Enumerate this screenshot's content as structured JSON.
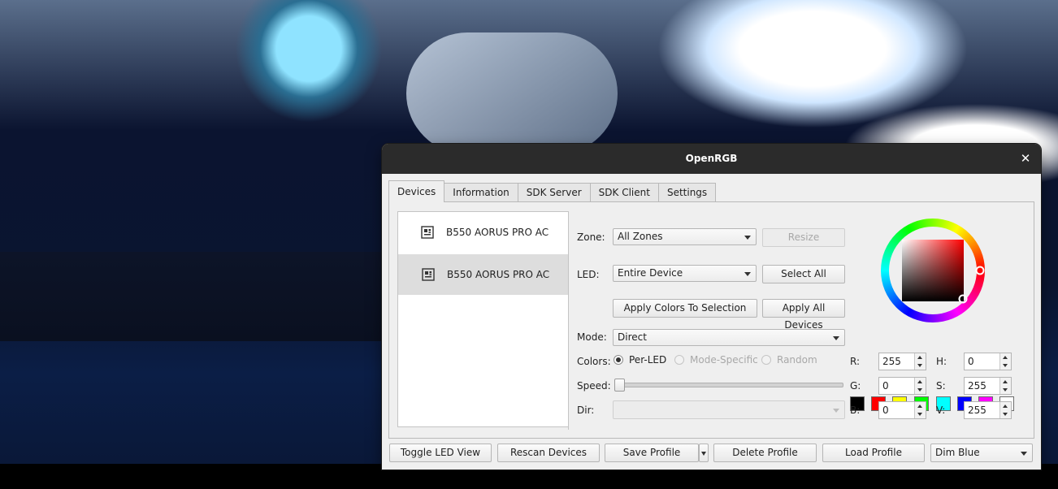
{
  "window": {
    "title": "OpenRGB",
    "close_glyph": "✕"
  },
  "tabs": [
    {
      "label": "Devices",
      "active": true
    },
    {
      "label": "Information"
    },
    {
      "label": "SDK Server"
    },
    {
      "label": "SDK Client"
    },
    {
      "label": "Settings"
    }
  ],
  "devices": [
    {
      "name": "B550 AORUS PRO AC",
      "icon": "motherboard-icon",
      "selected": false
    },
    {
      "name": "B550 AORUS PRO AC",
      "icon": "motherboard-icon",
      "selected": true
    }
  ],
  "controls": {
    "zone_label": "Zone:",
    "zone_value": "All Zones",
    "resize_label": "Resize",
    "led_label": "LED:",
    "led_value": "Entire Device",
    "select_all_label": "Select All",
    "apply_selection_label": "Apply Colors To Selection",
    "apply_all_label": "Apply All Devices",
    "mode_label": "Mode:",
    "mode_value": "Direct",
    "colors_label": "Colors:",
    "color_modes": [
      {
        "label": "Per-LED",
        "checked": true,
        "disabled": false
      },
      {
        "label": "Mode-Specific",
        "checked": false,
        "disabled": true
      },
      {
        "label": "Random",
        "checked": false,
        "disabled": true
      }
    ],
    "speed_label": "Speed:",
    "speed_value": 0,
    "dir_label": "Dir:",
    "dir_value": ""
  },
  "swatches": [
    "#000000",
    "#ff0000",
    "#ffff00",
    "#00ff00",
    "#00ffff",
    "#0000ff",
    "#ff00ff",
    "#ffffff"
  ],
  "rgb": {
    "r_label": "R:",
    "r": "255",
    "g_label": "G:",
    "g": "0",
    "b_label": "B:",
    "b": "0"
  },
  "hsv": {
    "h_label": "H:",
    "h": "0",
    "s_label": "S:",
    "s": "255",
    "v_label": "V:",
    "v": "255"
  },
  "selected_color": "#ff0000",
  "bottom": {
    "toggle_led_view": "Toggle LED View",
    "rescan_devices": "Rescan Devices",
    "save_profile": "Save Profile",
    "delete_profile": "Delete Profile",
    "load_profile": "Load Profile",
    "profile_value": "Dim Blue"
  }
}
